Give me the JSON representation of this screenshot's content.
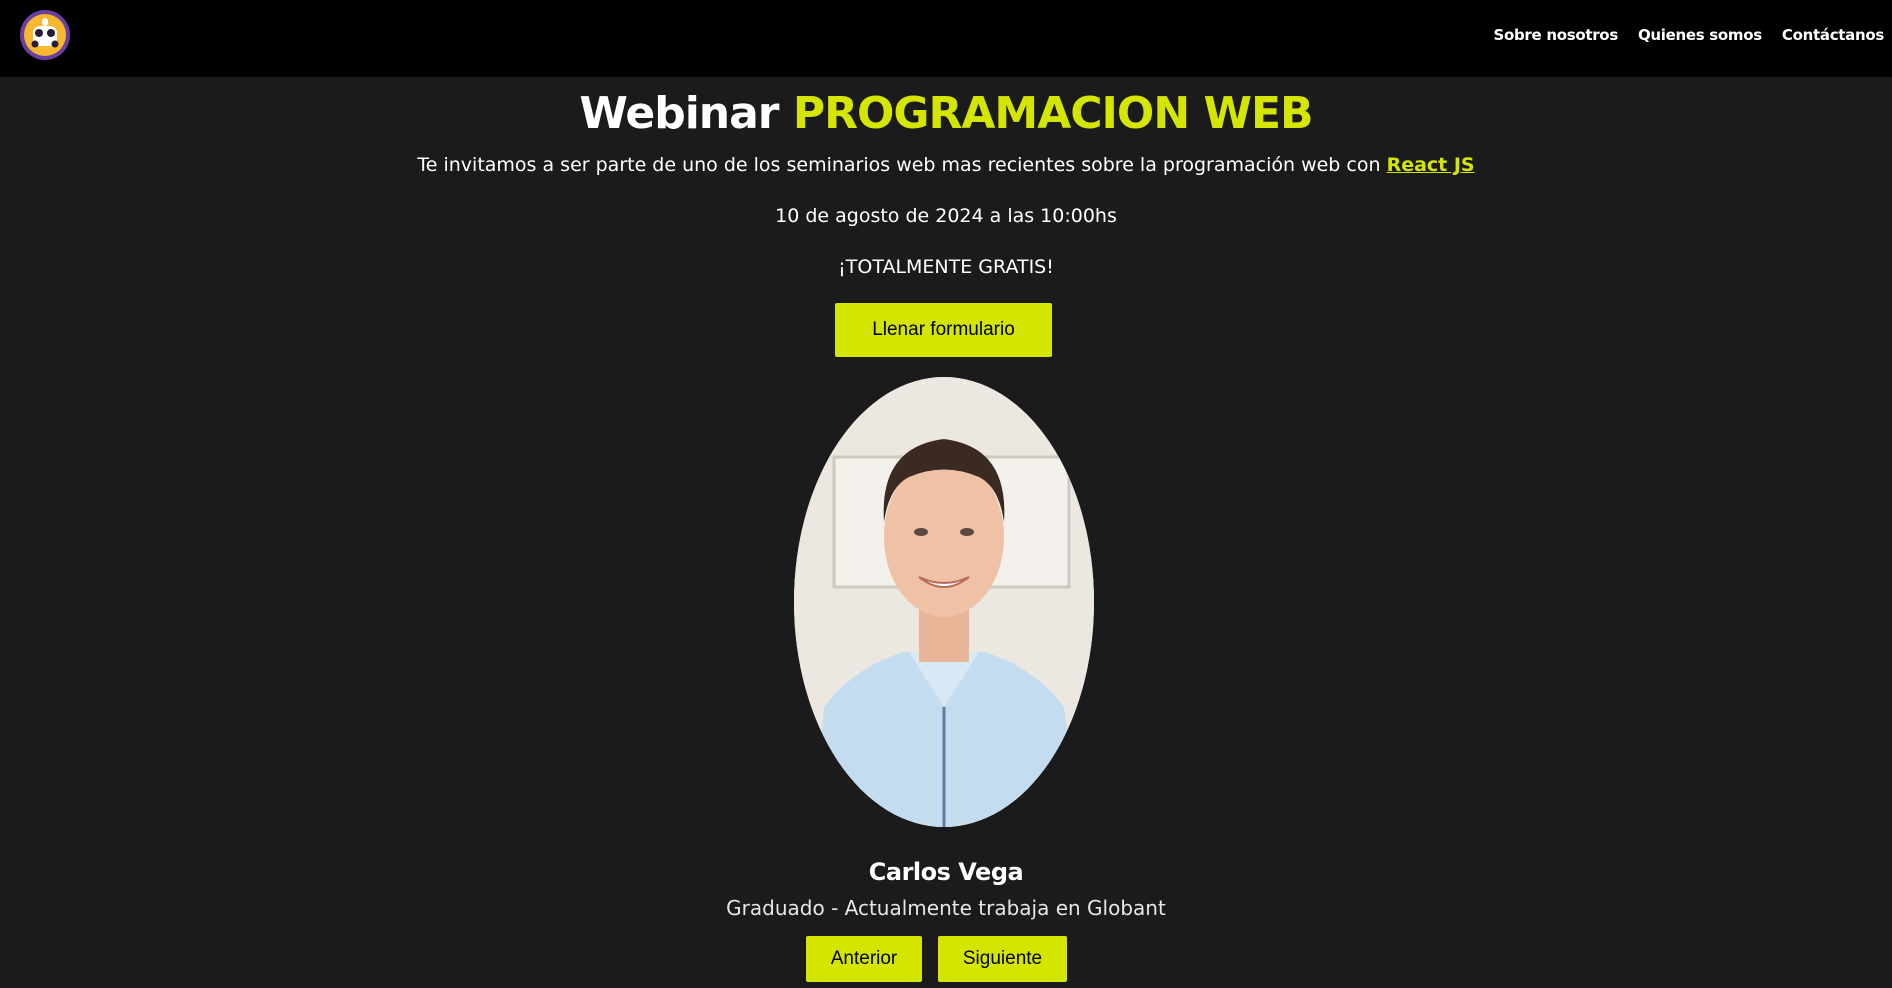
{
  "nav": {
    "logo_icon": "webinar-logo-icon",
    "links": [
      {
        "label": "Sobre nosotros"
      },
      {
        "label": "Quienes somos"
      },
      {
        "label": "Contáctanos"
      }
    ]
  },
  "hero": {
    "title_white": "Webinar",
    "title_accent": "PROGRAMACION WEB",
    "intro_text": "Te invitamos a ser parte de uno de los seminarios web mas recientes sobre la programación web con",
    "intro_link": "React JS",
    "date": "10 de agosto de 2024 a las 10:00hs",
    "free": "¡TOTALMENTE GRATIS!",
    "form_button": "Llenar formulario"
  },
  "speaker": {
    "name": "Carlos Vega",
    "role": "Graduado - Actualmente trabaja en Globant",
    "prev_button": "Anterior",
    "next_button": "Siguiente"
  },
  "colors": {
    "accent": "#d4e600",
    "background": "#1b1b1b",
    "navbar": "#000000"
  }
}
